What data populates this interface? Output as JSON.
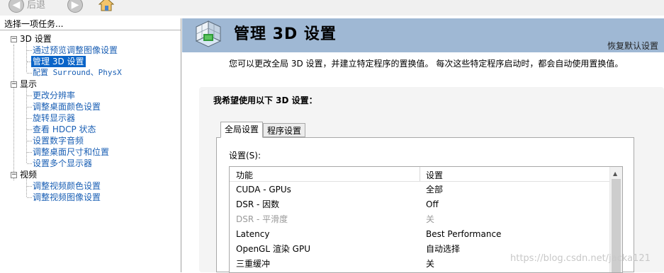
{
  "toolbar": {
    "back_label": "后退",
    "back_icon": "arrow-left-icon",
    "forward_icon": "arrow-right-icon",
    "home_icon": "home-icon"
  },
  "sidebar": {
    "header": "选择一项任务...",
    "categories": [
      {
        "label": "3D 设置",
        "items": [
          {
            "label": "通过预览调整图像设置"
          },
          {
            "label": "管理 3D 设置",
            "selected": true
          },
          {
            "label": "配置 Surround、PhysX"
          }
        ]
      },
      {
        "label": "显示",
        "items": [
          {
            "label": "更改分辨率"
          },
          {
            "label": "调整桌面颜色设置"
          },
          {
            "label": "旋转显示器"
          },
          {
            "label": "查看 HDCP 状态"
          },
          {
            "label": "设置数字音频"
          },
          {
            "label": "调整桌面尺寸和位置"
          },
          {
            "label": "设置多个显示器"
          }
        ]
      },
      {
        "label": "视频",
        "items": [
          {
            "label": "调整视频颜色设置"
          },
          {
            "label": "调整视频图像设置"
          }
        ]
      }
    ]
  },
  "header": {
    "title": "管理 3D 设置",
    "restore_label": "恢复默认设置",
    "icon": "3d-cube-icon"
  },
  "main": {
    "description": "您可以更改全局 3D 设置，并建立特定程序的置换值。 每次这些特定程序启动时，都会自动使用置换值。",
    "panel_heading": "我希望使用以下 3D 设置：",
    "tabs": [
      {
        "label": "全局设置",
        "active": true
      },
      {
        "label": "程序设置",
        "active": false
      }
    ],
    "settings_label": "设置(S):",
    "columns": [
      "功能",
      "设置"
    ],
    "rows": [
      {
        "feature": "CUDA - GPUs",
        "value": "全部"
      },
      {
        "feature": "DSR - 因数",
        "value": "Off"
      },
      {
        "feature": "DSR - 平滑度",
        "value": "关",
        "disabled": true
      },
      {
        "feature": "Latency",
        "value": "Best Performance"
      },
      {
        "feature": "OpenGL 渲染 GPU",
        "value": "自动选择"
      },
      {
        "feature": "三重缓冲",
        "value": "关"
      }
    ]
  },
  "watermark": "https://blog.csdn.net/jacka121",
  "colors": {
    "banner": "#9fb8d4",
    "selected": "#0a64c8",
    "link": "#1a5fb4"
  }
}
